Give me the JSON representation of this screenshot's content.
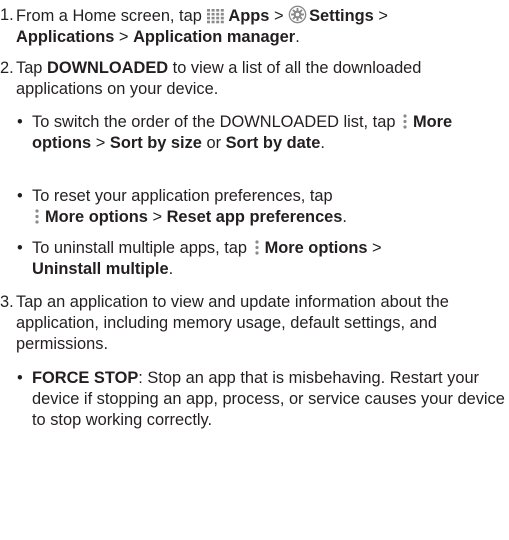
{
  "colors": {
    "text": "#231f20",
    "icon": "#8a8a8a"
  },
  "icons": {
    "apps": "apps-grid-icon",
    "settings": "settings-gear-icon",
    "more": "more-options-icon"
  },
  "steps": [
    {
      "number": "1.",
      "t1": "From a Home screen, tap",
      "apps": "Apps",
      "sep1": ">",
      "settings": "Settings",
      "sep2": ">",
      "applications": "Applications",
      "sep3": ">",
      "app_manager": "Application manager",
      "end": "."
    },
    {
      "number": "2.",
      "t1": "Tap",
      "downloaded": "DOWNLOADED",
      "t2": "to view a list of all the downloaded applications on your device.",
      "bullets": [
        {
          "t1": "To switch the order of the DOWNLOADED list, tap",
          "more": "More options",
          "sep": ">",
          "by_size": "Sort by size",
          "or": "or",
          "by_date": "Sort by date",
          "end": "."
        },
        {
          "t1": "To reset your application preferences, tap",
          "more": "More options",
          "sep": ">",
          "reset": "Reset app preferences",
          "end": "."
        },
        {
          "t1": "To uninstall multiple apps, tap",
          "more": "More options",
          "sep": ">",
          "uninstall": "Uninstall multiple",
          "end": "."
        }
      ]
    },
    {
      "number": "3.",
      "text": "Tap an application to view and update information about the application, including memory usage, default settings, and permissions.",
      "bullets": [
        {
          "term": "FORCE STOP",
          "text": ": Stop an app that is misbehaving. Restart your device if stopping an app, process, or service causes your device to stop working correctly."
        }
      ]
    }
  ]
}
